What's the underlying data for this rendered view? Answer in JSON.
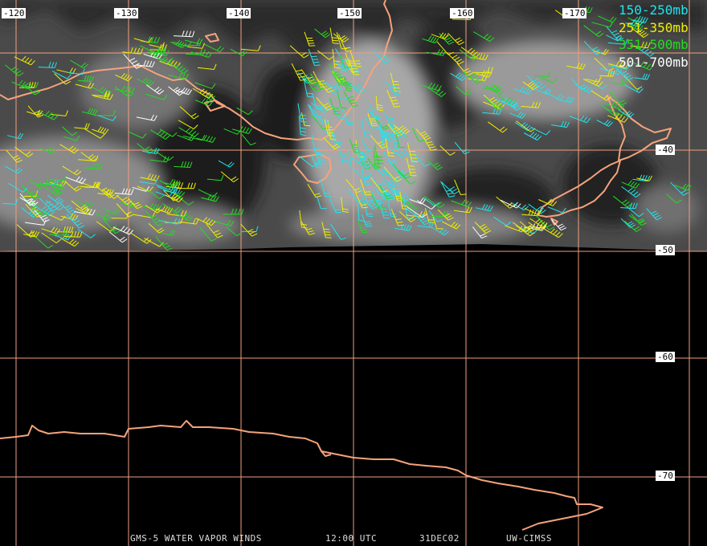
{
  "map": {
    "longitude_labels": [
      "-120",
      "-130",
      "-140",
      "-150",
      "-160",
      "-170"
    ],
    "latitude_labels": [
      "-40",
      "-50",
      "-60",
      "-70"
    ],
    "colors": {
      "grid": "#f0a080",
      "coast": "#f5a37c",
      "background": "#000000"
    }
  },
  "legend": [
    {
      "label": "150-250mb",
      "color": "#22e4ee"
    },
    {
      "label": "251-350mb",
      "color": "#f0f000"
    },
    {
      "label": "351-500mb",
      "color": "#22dd22"
    },
    {
      "label": "501-700mb",
      "color": "#ffffff"
    }
  ],
  "footer": {
    "satellite": "GMS-5 WATER VAPOR WINDS",
    "time": "12:00 UTC",
    "date": "31DEC02",
    "source": "UW-CIMSS"
  }
}
